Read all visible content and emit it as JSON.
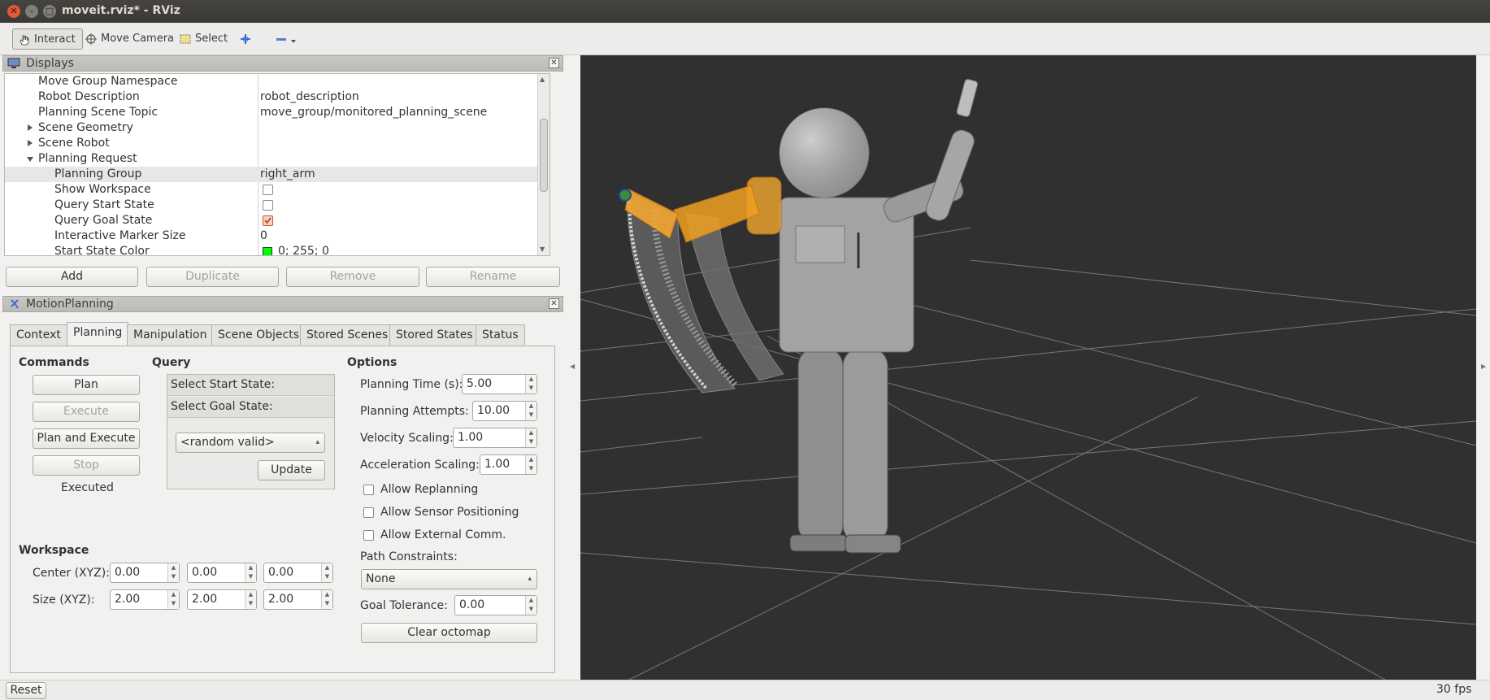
{
  "window": {
    "title": "moveit.rviz* - RViz"
  },
  "toolbar": {
    "interact": "Interact",
    "move_camera": "Move Camera",
    "select": "Select"
  },
  "displays": {
    "title": "Displays",
    "rows": [
      {
        "name": "Move Group Namespace",
        "value": ""
      },
      {
        "name": "Robot Description",
        "value": "robot_description"
      },
      {
        "name": "Planning Scene Topic",
        "value": "move_group/monitored_planning_scene"
      },
      {
        "name": "Scene Geometry",
        "value": ""
      },
      {
        "name": "Scene Robot",
        "value": ""
      },
      {
        "name": "Planning Request",
        "value": ""
      },
      {
        "name": "Planning Group",
        "value": "right_arm"
      },
      {
        "name": "Show Workspace",
        "value": ""
      },
      {
        "name": "Query Start State",
        "value": ""
      },
      {
        "name": "Query Goal State",
        "value": ""
      },
      {
        "name": "Interactive Marker Size",
        "value": "0"
      },
      {
        "name": "Start State Color",
        "value": "0; 255; 0"
      }
    ],
    "buttons": {
      "add": "Add",
      "duplicate": "Duplicate",
      "remove": "Remove",
      "rename": "Rename"
    }
  },
  "motion": {
    "title": "MotionPlanning",
    "tabs": [
      "Context",
      "Planning",
      "Manipulation",
      "Scene Objects",
      "Stored Scenes",
      "Stored States",
      "Status"
    ],
    "commands": {
      "heading": "Commands",
      "plan": "Plan",
      "execute": "Execute",
      "plan_execute": "Plan and Execute",
      "stop": "Stop",
      "status": "Executed"
    },
    "query": {
      "heading": "Query",
      "start": "Select Start State:",
      "goal": "Select Goal State:",
      "goal_choice": "<random valid>",
      "update": "Update"
    },
    "options": {
      "heading": "Options",
      "planning_time_label": "Planning Time (s):",
      "planning_time": "5.00",
      "attempts_label": "Planning Attempts:",
      "attempts": "10.00",
      "velocity_label": "Velocity Scaling:",
      "velocity": "1.00",
      "accel_label": "Acceleration Scaling:",
      "accel": "1.00",
      "replanning": "Allow Replanning",
      "sensor": "Allow Sensor Positioning",
      "external": "Allow External Comm.",
      "path_label": "Path Constraints:",
      "path": "None",
      "goal_tol_label": "Goal Tolerance:",
      "goal_tol": "0.00",
      "clear": "Clear octomap"
    },
    "workspace": {
      "heading": "Workspace",
      "center_label": "Center (XYZ):",
      "center": [
        "0.00",
        "0.00",
        "0.00"
      ],
      "size_label": "Size (XYZ):",
      "size": [
        "2.00",
        "2.00",
        "2.00"
      ]
    }
  },
  "status": {
    "reset": "Reset",
    "fps": "30 fps"
  },
  "colors": {
    "start_state": "#00ff00",
    "viewport_bg": "#303030",
    "arm_highlight": "#f0a020"
  }
}
